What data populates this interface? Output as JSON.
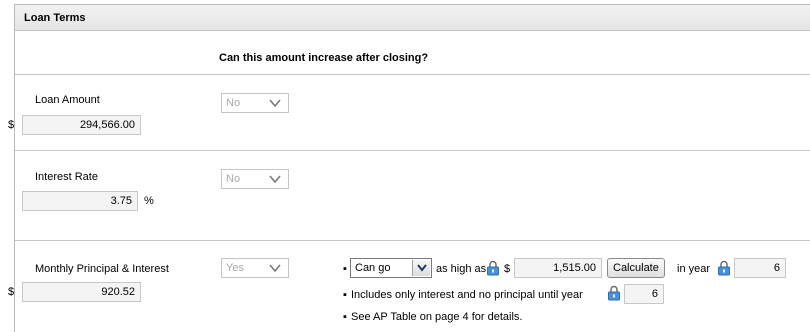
{
  "panel": {
    "title": "Loan Terms"
  },
  "question": "Can this amount increase after closing?",
  "currency_symbol": "$",
  "loan_amount": {
    "label": "Loan Amount",
    "value": "294,566.00",
    "increase": "No"
  },
  "interest_rate": {
    "label": "Interest Rate",
    "value": "3.75",
    "unit": "%",
    "increase": "No"
  },
  "monthly_pi": {
    "label": "Monthly Principal & Interest",
    "value": "920.52",
    "increase": "Yes",
    "detail": {
      "bullet": "▪",
      "can_go_option": "Can go",
      "as_high_as": "as high as",
      "dollar": "$",
      "max_amount": "1,515.00",
      "calculate_button": "Calculate",
      "in_year": "in year",
      "year_value": "6",
      "interest_only_text": "Includes only interest and no principal until year",
      "interest_only_year": "6",
      "ap_table_text": "See AP Table on page 4 for details."
    }
  },
  "colors": {
    "lock_blue": "#4a8fd8",
    "border": "#c6c6c6",
    "field_bg": "#f4f4f4"
  },
  "icons": {
    "lock": "lock-icon",
    "chevron": "chevron-down-icon"
  }
}
